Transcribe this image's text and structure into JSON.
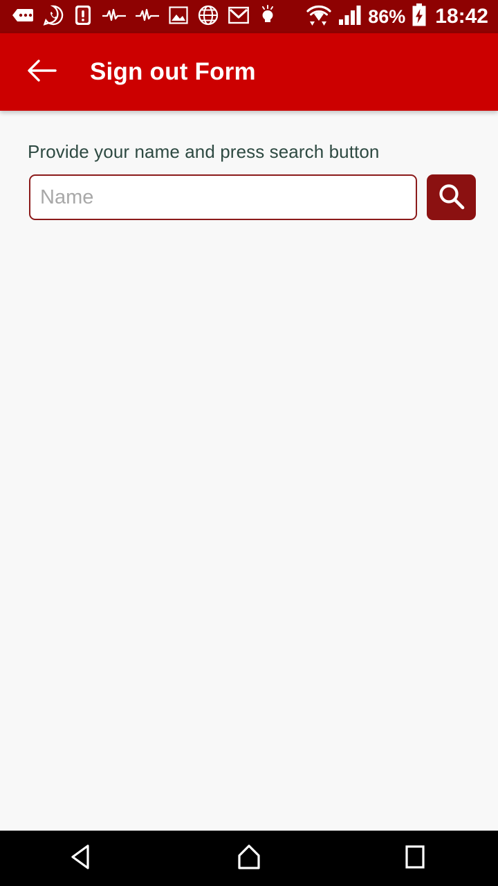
{
  "status_bar": {
    "background_color": "#8E0202",
    "notification_icons": [
      {
        "name": "messages-icon",
        "label": "Messages"
      },
      {
        "name": "whatsapp-icon",
        "label": "WhatsApp"
      },
      {
        "name": "alert-icon",
        "label": "Alert"
      },
      {
        "name": "pulse-icon-1",
        "label": "Pulse"
      },
      {
        "name": "pulse-icon-2",
        "label": "Pulse"
      },
      {
        "name": "image-icon",
        "label": "Screenshot"
      },
      {
        "name": "globe-icon",
        "label": "Browser"
      },
      {
        "name": "gmail-icon",
        "label": "Gmail"
      },
      {
        "name": "lightbulb-icon",
        "label": "Tips"
      }
    ],
    "wifi_icon": "wifi-icon",
    "signal_icon": "signal-bars-icon",
    "battery_percent": "86%",
    "battery_icon": "battery-charging-icon",
    "clock": "18:42"
  },
  "app_bar": {
    "background_color": "#CC0000",
    "back_icon": "back-arrow-icon",
    "title": "Sign out Form"
  },
  "content": {
    "background_color": "#F8F8F8",
    "hint_label": "Provide your name and press search button",
    "hint_color": "#2E4A42",
    "name_input": {
      "value": "",
      "placeholder": "Name",
      "border_color": "#8B1A1A"
    },
    "search_button": {
      "icon": "search-icon",
      "background_color": "#8B1111"
    }
  },
  "nav_bar": {
    "background_color": "#000000",
    "back": "nav-back-icon",
    "home": "nav-home-icon",
    "recents": "nav-recents-icon"
  }
}
